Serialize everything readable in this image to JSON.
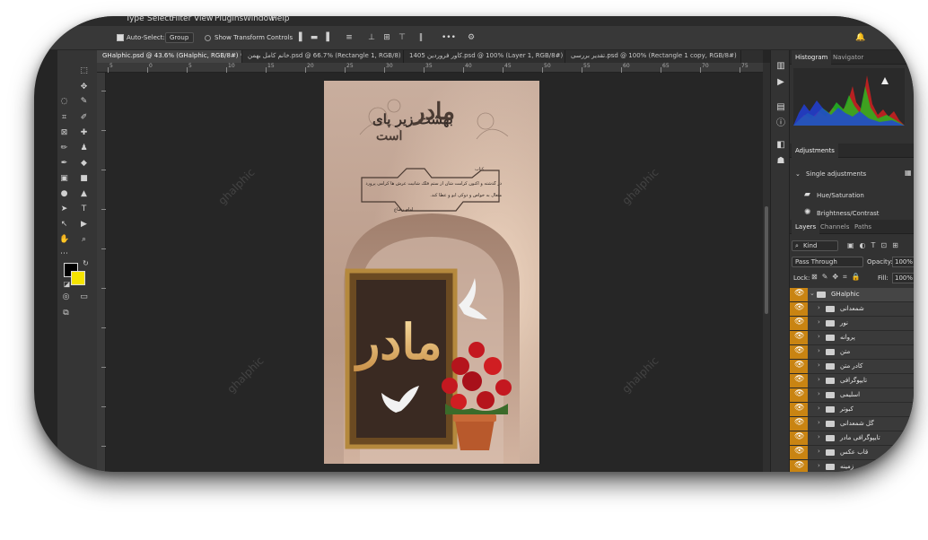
{
  "menubar": {
    "items": [
      "Type",
      "Select",
      "Filter",
      "View",
      "Plugins",
      "Window",
      "Help"
    ]
  },
  "options": {
    "auto_select_label": "Auto-Select:",
    "auto_select_value": "Group",
    "transform_label": "Show Transform Controls",
    "more_label": "•••"
  },
  "tabs": [
    {
      "label": "GHalphic.psd @ 43.6% (GHalphic, RGB/8#) *"
    },
    {
      "label": "خانم کامل بهمن.psd @ 66.7% (Rectangle 1, RGB/8)"
    },
    {
      "label": "1405 کاور فروردین.psd @ 100% (Layer 1, RGB/8#)"
    },
    {
      "label": "تقدیر بررسی.psd @ 100% (Rectangle 1 copy, RGB/8#)"
    }
  ],
  "ruler_numbers": [
    "5",
    "0",
    "5",
    "10",
    "15",
    "20",
    "25",
    "30",
    "35",
    "40",
    "45",
    "50",
    "55",
    "60",
    "65",
    "70",
    "75"
  ],
  "document": {
    "title_small": "بهشت زیر پای",
    "title_big": "مادر",
    "title_end": "است",
    "frame_heading": "کتاب",
    "poem_line1": "در گذشته و اکنون کرامت شان از ستم فلک شأنیت عرش ها کرامی پرورده کار",
    "poem_line2": "متعال به خواص و دوکی ابو و عطا کند.",
    "signature": "امام رضاع",
    "hero_text": "مادر",
    "watermark": "ghalphic"
  },
  "panels": {
    "top_tabs": [
      "Histogram",
      "Navigator"
    ],
    "adjustments_tab": "Adjustments",
    "single_adjustments": "Single adjustments",
    "adj_items": [
      "Hue/Saturation",
      "Brightness/Contrast"
    ],
    "layer_tabs": [
      "Layers",
      "Channels",
      "Paths"
    ],
    "kind_label": "Kind",
    "blend_mode": "Pass Through",
    "opacity_label": "Opacity:",
    "opacity_value": "100%",
    "lock_label": "Lock:",
    "fill_label": "Fill:",
    "fill_value": "100%",
    "group_name": "GHalphic",
    "layers": [
      "شمعدانی",
      "نور",
      "پروانه",
      "متن",
      "کادر متن",
      "تایپوگرافی",
      "اسلیمی",
      "کبوتر",
      "گل شمعدانی",
      "تایپوگرافی مادر",
      "قاب عکس",
      "زمینه"
    ]
  },
  "colors": {
    "eye_column": "#c98412",
    "foreground": "#000000",
    "background": "#f5e400"
  }
}
